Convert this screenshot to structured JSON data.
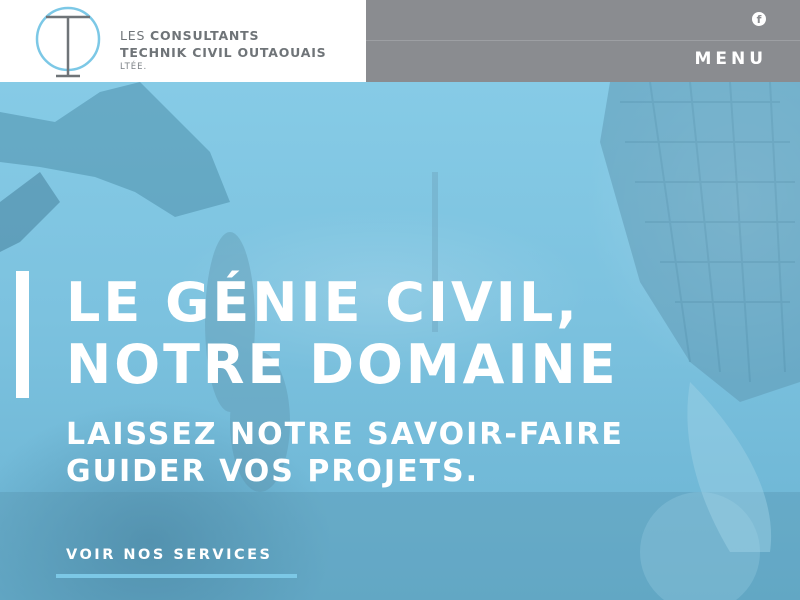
{
  "logo": {
    "line1_light": "LES",
    "line1_bold": "CONSULTANTS",
    "line2": "TECHNIK CIVIL OUTAOUAIS",
    "line3": "LTÉE."
  },
  "nav": {
    "facebook_icon": "facebook-icon",
    "facebook_glyph": "f",
    "menu_label": "MENU"
  },
  "hero": {
    "headline_line1": "LE GÉNIE CIVIL,",
    "headline_line2": "NOTRE DOMAINE",
    "subheadline_line1": "LAISSEZ NOTRE SAVOIR-FAIRE",
    "subheadline_line2": "GUIDER VOS PROJETS.",
    "cta_label": "VOIR NOS SERVICES"
  },
  "colors": {
    "brand_blue": "#7cc8e6",
    "header_gray": "#8a8c90",
    "logo_text": "#6f7478",
    "white": "#ffffff"
  }
}
